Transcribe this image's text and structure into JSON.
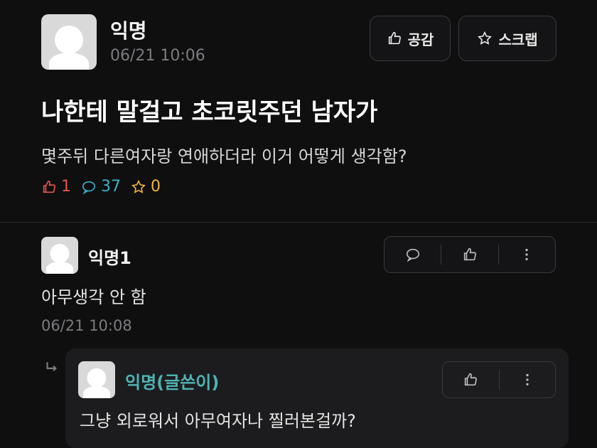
{
  "post": {
    "author": "익명",
    "timestamp": "06/21 10:06",
    "like_button_label": "공감",
    "scrap_button_label": "스크랩",
    "title": "나한테 말걸고 초코릿주던 남자가",
    "body": "몇주뒤 다른여자랑 연애하더라 이거 어떻게 생각함?",
    "stats": {
      "likes": "1",
      "comments": "37",
      "scraps": "0"
    },
    "stat_colors": {
      "likes": "#e5564a",
      "comments": "#3bb0c7",
      "scraps": "#f0b43c"
    }
  },
  "comment": {
    "author": "익명1",
    "text": "아무생각 안 함",
    "timestamp": "06/21 10:08"
  },
  "reply": {
    "author": "익명(글쓴이)",
    "author_color": "#4fb3b3",
    "text": "그냥 외로워서 아무여자나 찔러본걸까?"
  },
  "icons": {
    "thumb": "thumbs-up-icon",
    "star": "star-icon",
    "comment": "comment-bubble-icon",
    "more": "more-vertical-icon",
    "reply_arrow": "reply-arrow-icon"
  }
}
